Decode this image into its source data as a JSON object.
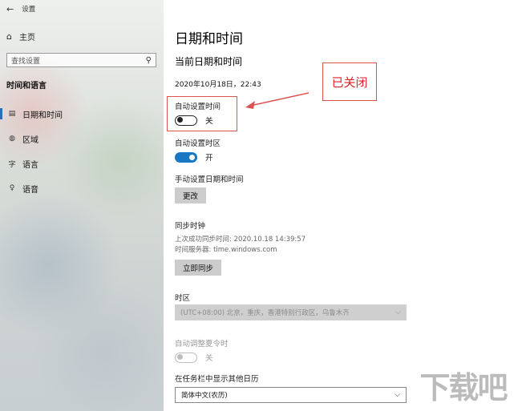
{
  "sidebar": {
    "app_title": "设置",
    "home_label": "主页",
    "search_placeholder": "查找设置",
    "section_title": "时间和语言",
    "items": [
      {
        "icon": "calendar-clock-icon",
        "label": "日期和时间",
        "active": true
      },
      {
        "icon": "globe-icon",
        "label": "区域",
        "active": false
      },
      {
        "icon": "language-icon",
        "label": "语言",
        "active": false
      },
      {
        "icon": "microphone-icon",
        "label": "语音",
        "active": false
      }
    ]
  },
  "main": {
    "page_title": "日期和时间",
    "section_title": "当前日期和时间",
    "current_datetime": "2020年10月18日，22:43",
    "auto_time": {
      "label": "自动设置时间",
      "state_text": "关",
      "on": false
    },
    "auto_timezone": {
      "label": "自动设置时区",
      "state_text": "开",
      "on": true
    },
    "manual": {
      "label": "手动设置日期和时间",
      "button": "更改"
    },
    "sync": {
      "label": "同步时钟",
      "last_sync": "上次成功同步时间: 2020.10.18 14:39:57",
      "server": "时间服务器: time.windows.com",
      "button": "立即同步"
    },
    "timezone": {
      "label": "时区",
      "value": "(UTC+08:00) 北京，重庆，香港特别行政区，乌鲁木齐"
    },
    "dst": {
      "label": "自动调整夏令时",
      "state_text": "关"
    },
    "extra_calendar": {
      "label": "在任务栏中显示其他日历",
      "value": "简体中文(农历)"
    }
  },
  "annotation": {
    "text": "已关闭",
    "color": "#e0202a"
  },
  "colors": {
    "accent": "#1a78c2",
    "annotation_red": "#d9534f"
  }
}
